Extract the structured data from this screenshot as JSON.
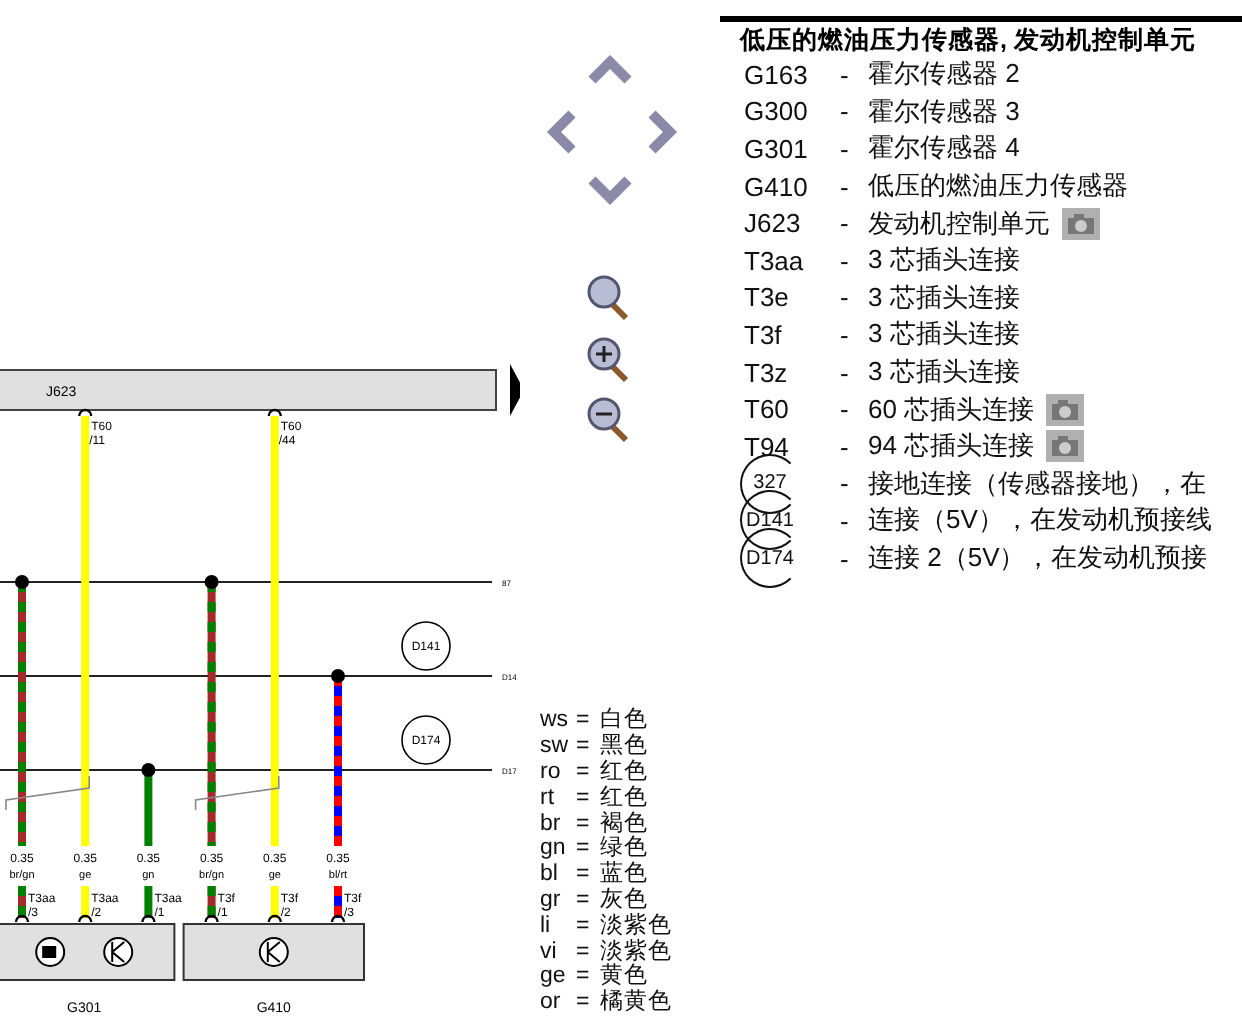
{
  "diagram": {
    "control_unit": {
      "label": "J623"
    },
    "buses": [
      {
        "label": "87"
      },
      {
        "label": "D14",
        "splice": "D141"
      },
      {
        "label": "D17",
        "splice": "D174"
      }
    ],
    "components": [
      {
        "label": "G301",
        "symbols": [
          {
            "kind": "square"
          },
          {
            "kind": "hall"
          }
        ],
        "wires": [
          {
            "kind": "bus1",
            "color": "#a52a2a",
            "stripe": {
              "color": "#008000"
            },
            "size": "0.35",
            "code": "br/gn",
            "connector": "T3aa",
            "pin": "/3"
          },
          {
            "kind": "unit",
            "color": "#ffff00",
            "size": "0.35",
            "code": "ge",
            "connector": "T3aa",
            "pin": "/2",
            "top": {
              "label": "T60",
              "pin": "/11"
            }
          },
          {
            "kind": "bus3",
            "color": "#008000",
            "size": "0.35",
            "code": "gn",
            "connector": "T3aa",
            "pin": "/1"
          }
        ]
      },
      {
        "label": "G410",
        "symbols": [
          {
            "kind": "hall"
          }
        ],
        "wires": [
          {
            "kind": "bus1",
            "color": "#a52a2a",
            "stripe": {
              "color": "#008000"
            },
            "size": "0.35",
            "code": "br/gn",
            "connector": "T3f",
            "pin": "/1"
          },
          {
            "kind": "unit",
            "color": "#ffff00",
            "size": "0.35",
            "code": "ge",
            "connector": "T3f",
            "pin": "/2",
            "top": {
              "label": "T60",
              "pin": "/44"
            }
          },
          {
            "kind": "bus2",
            "color": "#0000ff",
            "stripe": {
              "color": "#ff0000"
            },
            "size": "0.35",
            "code": "bl/rt",
            "connector": "T3f",
            "pin": "/3"
          }
        ]
      }
    ]
  },
  "color_separator": "=",
  "legend_separator": "-",
  "color_codes": [
    {
      "code": "ws",
      "name": "白色"
    },
    {
      "code": "sw",
      "name": "黑色"
    },
    {
      "code": "ro",
      "name": "红色"
    },
    {
      "code": "rt",
      "name": "红色"
    },
    {
      "code": "br",
      "name": "褐色"
    },
    {
      "code": "gn",
      "name": "绿色"
    },
    {
      "code": "bl",
      "name": "蓝色"
    },
    {
      "code": "gr",
      "name": "灰色"
    },
    {
      "code": "li",
      "name": "淡紫色"
    },
    {
      "code": "vi",
      "name": "淡紫色"
    },
    {
      "code": "ge",
      "name": "黄色"
    },
    {
      "code": "or",
      "name": "橘黄色"
    }
  ],
  "legend": {
    "title": "低压的燃油压力传感器, 发动机控制单元",
    "items": [
      {
        "kind": "code",
        "code": "G163",
        "text": "霍尔传感器 2",
        "camera": false
      },
      {
        "kind": "code",
        "code": "G300",
        "text": "霍尔传感器 3",
        "camera": false
      },
      {
        "kind": "code",
        "code": "G301",
        "text": "霍尔传感器 4",
        "camera": false
      },
      {
        "kind": "code",
        "code": "G410",
        "text": "低压的燃油压力传感器",
        "camera": false
      },
      {
        "kind": "code",
        "code": "J623",
        "text": "发动机控制单元",
        "camera": true
      },
      {
        "kind": "code",
        "code": "T3aa",
        "text": "3 芯插头连接",
        "camera": false
      },
      {
        "kind": "code",
        "code": "T3e",
        "text": "3 芯插头连接",
        "camera": false
      },
      {
        "kind": "code",
        "code": "T3f",
        "text": "3 芯插头连接",
        "camera": false
      },
      {
        "kind": "code",
        "code": "T3z",
        "text": "3 芯插头连接",
        "camera": false
      },
      {
        "kind": "code",
        "code": "T60",
        "text": "60 芯插头连接",
        "camera": true
      },
      {
        "kind": "code",
        "code": "T94",
        "text": "94 芯插头连接",
        "camera": true
      },
      {
        "kind": "circle",
        "code": "327",
        "text": "接地连接（传感器接地），在",
        "camera": false
      },
      {
        "kind": "circle",
        "code": "D141",
        "text": "连接（5V），在发动机预接线",
        "camera": false
      },
      {
        "kind": "circle",
        "code": "D174",
        "text": "连接 2（5V），在发动机预接",
        "camera": false
      }
    ]
  }
}
